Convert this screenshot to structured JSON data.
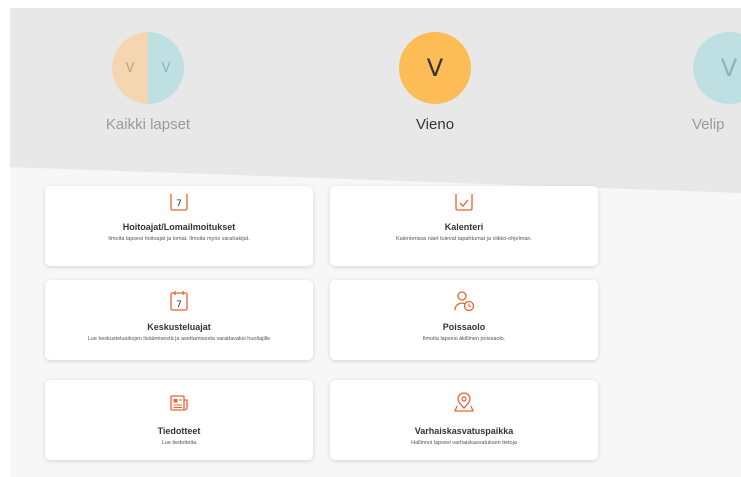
{
  "children": {
    "all": {
      "label": "Kaikki lapset",
      "initials": [
        "V",
        "V"
      ]
    },
    "vieno": {
      "label": "Vieno",
      "initial": "V"
    },
    "veli": {
      "label": "Velip",
      "initial": "V"
    }
  },
  "cards": {
    "hoitoajat": {
      "title": "Hoitoajat/Lomailmoitukset",
      "desc": "Ilmoita lapsesi hoitoajat ja lomat. Ilmoita myös varahakijat.",
      "icon": "calendar-7-icon"
    },
    "kalenteri": {
      "title": "Kalenteri",
      "desc": "Kalenterissa näet tulevat tapahtumat ja viikko-ohjelman.",
      "icon": "calendar-check-icon"
    },
    "keskusteluajat": {
      "title": "Keskusteluajat",
      "desc": "Lue keskusteluaikojen lisäämisestä ja asettamisesta varattavaksi huoltajille",
      "icon": "calendar-7-icon"
    },
    "poissaolo": {
      "title": "Poissaolo",
      "desc": "Ilmoita lapsesi äkillinen poissaolo.",
      "icon": "person-clock-icon"
    },
    "tiedotteet": {
      "title": "Tiedotteet",
      "desc": "Lue tiedotteita",
      "icon": "newspaper-icon"
    },
    "varhaiskasvatuspaikka": {
      "title": "Varhaiskasvatuspaikka",
      "desc": "Hallinnoi lapsesi varhaiskasvatuksen tietoja",
      "icon": "map-pin-icon"
    }
  },
  "colors": {
    "accent": "#e8652d",
    "active_avatar": "#fdbc55",
    "header_bg": "#e8e8e8"
  }
}
